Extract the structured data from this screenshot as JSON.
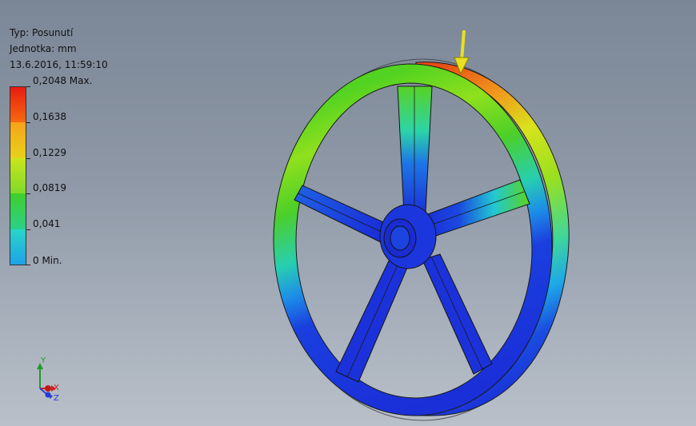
{
  "result_info": {
    "type_line": "Typ: Posunutí",
    "unit_line": "Jednotka: mm",
    "timestamp_line": "13.6.2016, 11:59:10"
  },
  "legend": {
    "max_label": "0,2048 Max.",
    "labels": [
      "0,2048 Max.",
      "0,1638",
      "0,1229",
      "0,0819",
      "0,041",
      "0 Min."
    ],
    "colors": [
      "#e81c10",
      "#f7a21a",
      "#c9e51c",
      "#3fcf2a",
      "#28d6c9",
      "#1d5fe8",
      "#1a2bd6"
    ]
  },
  "triad": {
    "x_label": "X",
    "y_label": "Y",
    "z_label": "Z",
    "x_color": "#d11f1f",
    "y_color": "#1f9a2a",
    "z_color": "#2a3bd6"
  },
  "model": {
    "name": "wheel-displacement-model",
    "load_arrow_color": "#e8e020"
  }
}
